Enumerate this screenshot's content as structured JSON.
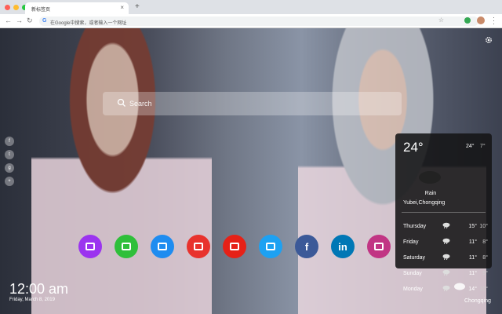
{
  "browser": {
    "tab_title": "新标签页",
    "tab_close": "×",
    "new_tab": "+",
    "omnibox_placeholder": "在Google中搜索，或者输入一个网址"
  },
  "colors": {
    "instagram": "#c13584",
    "twitter": "#1da1f2",
    "facebook": "#3b5998",
    "linkedin": "#0077b5",
    "youtube": "#e62117"
  },
  "search": {
    "placeholder": "Search"
  },
  "shortcuts": [
    {
      "name": "image-editor",
      "icon": "picture-icon",
      "color": "#9b34ef"
    },
    {
      "name": "checklist",
      "icon": "check-icon",
      "color": "#2fbf3a"
    },
    {
      "name": "news",
      "icon": "newspaper-icon",
      "color": "#1e8cf0"
    },
    {
      "name": "paint",
      "icon": "palette-icon",
      "color": "#e8322d"
    },
    {
      "name": "youtube",
      "icon": "youtube-icon",
      "color": "#e62117"
    },
    {
      "name": "twitter",
      "icon": "twitter-icon",
      "color": "#1da1f2"
    },
    {
      "name": "facebook",
      "icon": "facebook-icon",
      "label": "f",
      "color": "#3b5998"
    },
    {
      "name": "linkedin",
      "icon": "linkedin-icon",
      "label": "in",
      "color": "#0077b5"
    },
    {
      "name": "instagram",
      "icon": "instagram-icon",
      "color": "#c13584"
    }
  ],
  "weather": {
    "temp": "24°",
    "hi": "24°",
    "lo": "7°",
    "condition": "Rain",
    "city": "Yubei,Chongqing",
    "forecast": [
      {
        "day": "Thursday",
        "hi": "15°",
        "lo": "10°"
      },
      {
        "day": "Friday",
        "hi": "11°",
        "lo": "8°"
      },
      {
        "day": "Saturday",
        "hi": "11°",
        "lo": "8°"
      },
      {
        "day": "Sunday",
        "hi": "11°",
        "lo": "9°"
      },
      {
        "day": "Monday",
        "hi": "14°",
        "lo": "10°"
      }
    ]
  },
  "clock": {
    "time": "12:00 am",
    "date": "Friday, March 8, 2019"
  },
  "bottom_city": "Chongqing"
}
